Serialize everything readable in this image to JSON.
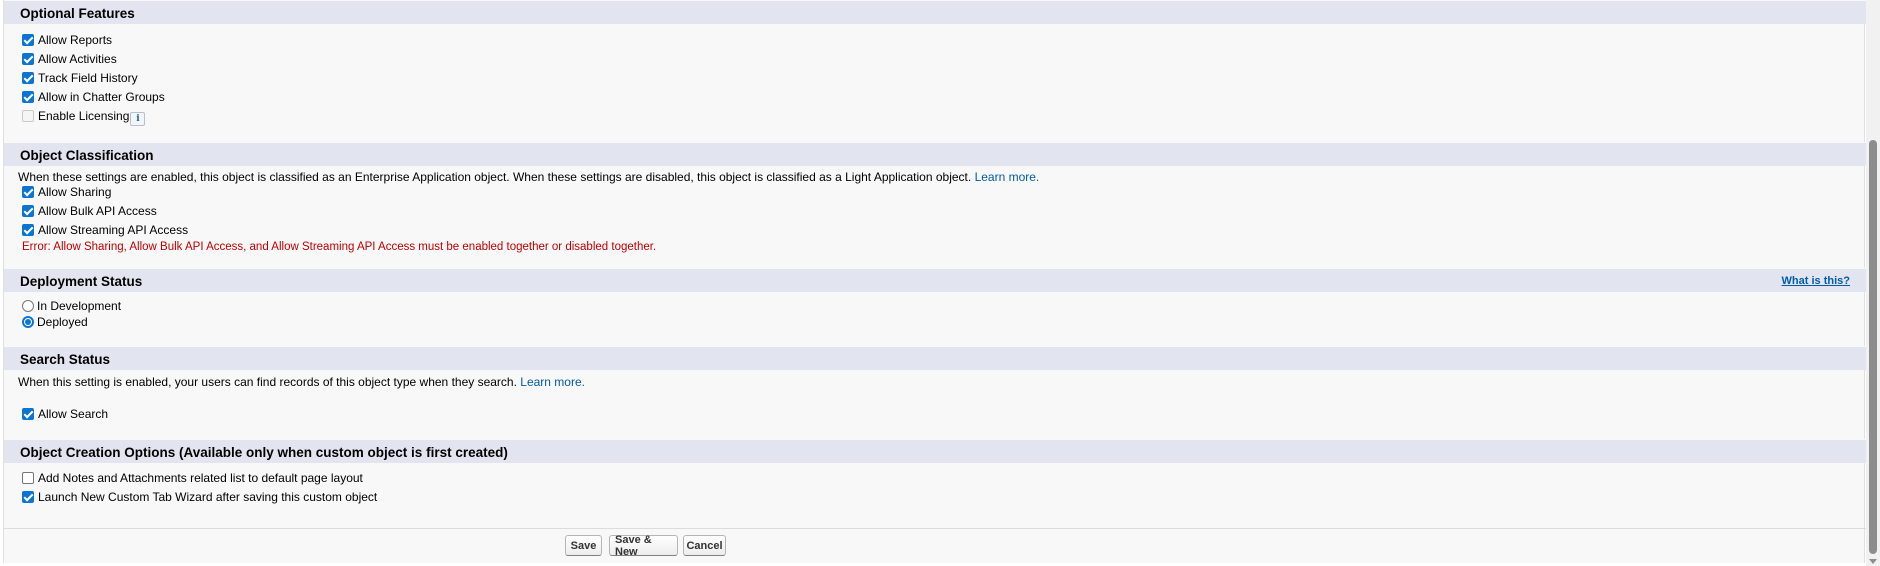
{
  "optional_features": {
    "title": "Optional Features",
    "items": [
      {
        "label": "Allow Reports",
        "checked": true
      },
      {
        "label": "Allow Activities",
        "checked": true
      },
      {
        "label": "Track Field History",
        "checked": true
      },
      {
        "label": "Allow in Chatter Groups",
        "checked": true
      },
      {
        "label": "Enable Licensing",
        "checked": false,
        "disabled": true,
        "icon": "info-icon",
        "icon_glyph": "i"
      }
    ]
  },
  "object_classification": {
    "title": "Object Classification",
    "description": "When these settings are enabled, this object is classified as an Enterprise Application object. When these settings are disabled, this object is classified as a Light Application object.",
    "learn_more": "Learn more.",
    "items": [
      {
        "label": "Allow Sharing",
        "checked": true
      },
      {
        "label": "Allow Bulk API Access",
        "checked": true
      },
      {
        "label": "Allow Streaming API Access",
        "checked": true
      }
    ],
    "error": "Error: Allow Sharing, Allow Bulk API Access, and Allow Streaming API Access must be enabled together or disabled together."
  },
  "deployment_status": {
    "title": "Deployment Status",
    "help_link": "What is this?",
    "options": [
      {
        "label": "In Development",
        "selected": false
      },
      {
        "label": "Deployed",
        "selected": true
      }
    ]
  },
  "search_status": {
    "title": "Search Status",
    "description": "When this setting is enabled, your users can find records of this object type when they search.",
    "learn_more": "Learn more.",
    "items": [
      {
        "label": "Allow Search",
        "checked": true
      }
    ]
  },
  "object_creation_options": {
    "title": "Object Creation Options (Available only when custom object is first created)",
    "items": [
      {
        "label": "Add Notes and Attachments related list to default page layout",
        "checked": false
      },
      {
        "label": "Launch New Custom Tab Wizard after saving this custom object",
        "checked": true
      }
    ]
  },
  "buttons": {
    "save": "Save",
    "save_new": "Save & New",
    "cancel": "Cancel"
  },
  "colors": {
    "section_header_bg": "#e2e5ef",
    "checkbox_checked": "#0b75d1",
    "link": "#015ba7",
    "error": "#c00000"
  }
}
